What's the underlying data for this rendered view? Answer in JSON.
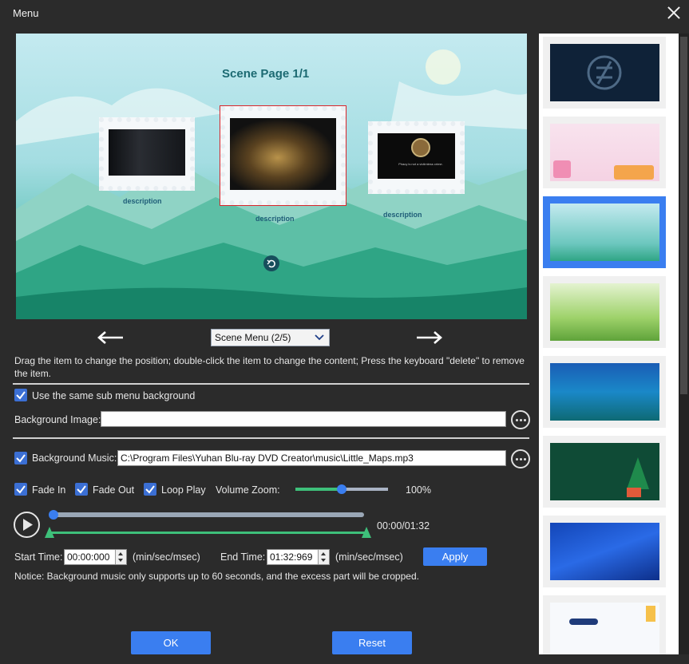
{
  "window": {
    "title": "Menu"
  },
  "preview": {
    "scene_title": "Scene Page  1/1",
    "items": [
      {
        "description": "description"
      },
      {
        "description": "description"
      },
      {
        "description": "description"
      }
    ],
    "third_thumb_text": "Piracy is not a victimless crime."
  },
  "nav": {
    "scene_select": "Scene Menu (2/5)"
  },
  "hint": "Drag the item to change the position; double-click the item to change the content; Press the keyboard \"delete\" to remove the item.",
  "background": {
    "same_sub_menu_label": "Use the same sub menu background",
    "same_sub_menu_checked": true,
    "image_label": "Background Image:",
    "image_value": ""
  },
  "music": {
    "label": "Background Music:",
    "checked": true,
    "path": "C:\\Program Files\\Yuhan Blu-ray DVD Creator\\music\\Little_Maps.mp3",
    "fade_in": "Fade In",
    "fade_out": "Fade Out",
    "loop_play": "Loop Play",
    "volume_label": "Volume Zoom:",
    "volume_value": "100%",
    "volume_level": 0.5,
    "time_display": "00:00/01:32",
    "start_label": "Start Time:",
    "start_value": "00:00:000",
    "end_label": "End Time:",
    "end_value": "01:32:969",
    "unit": "(min/sec/msec)",
    "apply": "Apply",
    "notice": "Notice: Background music only supports up to 60 seconds, and the excess part will be cropped."
  },
  "footer": {
    "ok": "OK",
    "reset": "Reset"
  },
  "colors": {
    "accent": "#3a7ef0",
    "background": "#2b2b2b",
    "range": "#3ec07a"
  }
}
